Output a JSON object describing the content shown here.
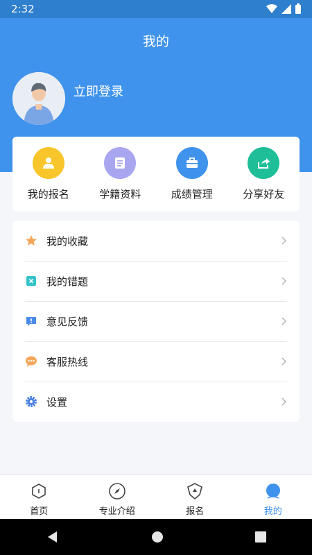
{
  "status_bar": {
    "time": "2:32"
  },
  "header": {
    "title": "我的",
    "login_text": "立即登录"
  },
  "quick_actions": [
    {
      "label": "我的报名",
      "icon": "user-icon",
      "color": "#f8c62a"
    },
    {
      "label": "学籍资料",
      "icon": "document-icon",
      "color": "#a9a6f0"
    },
    {
      "label": "成绩管理",
      "icon": "briefcase-icon",
      "color": "#3f93ec"
    },
    {
      "label": "分享好友",
      "icon": "share-icon",
      "color": "#1ebf98"
    }
  ],
  "menu": [
    {
      "label": "我的收藏",
      "icon": "star-icon",
      "color": "#f5a55b"
    },
    {
      "label": "我的错题",
      "icon": "wrong-answer-icon",
      "color": "#34c3c9"
    },
    {
      "label": "意见反馈",
      "icon": "feedback-icon",
      "color": "#4a8be8"
    },
    {
      "label": "客服热线",
      "icon": "chat-icon",
      "color": "#f5a55b"
    },
    {
      "label": "设置",
      "icon": "settings-icon",
      "color": "#4a7fe0"
    }
  ],
  "bottom_nav": [
    {
      "label": "首页",
      "icon": "home-icon",
      "active": false
    },
    {
      "label": "专业介绍",
      "icon": "compass-icon",
      "active": false
    },
    {
      "label": "报名",
      "icon": "signup-icon",
      "active": false
    },
    {
      "label": "我的",
      "icon": "profile-icon",
      "active": true
    }
  ],
  "accent_color": "#3f93ec"
}
